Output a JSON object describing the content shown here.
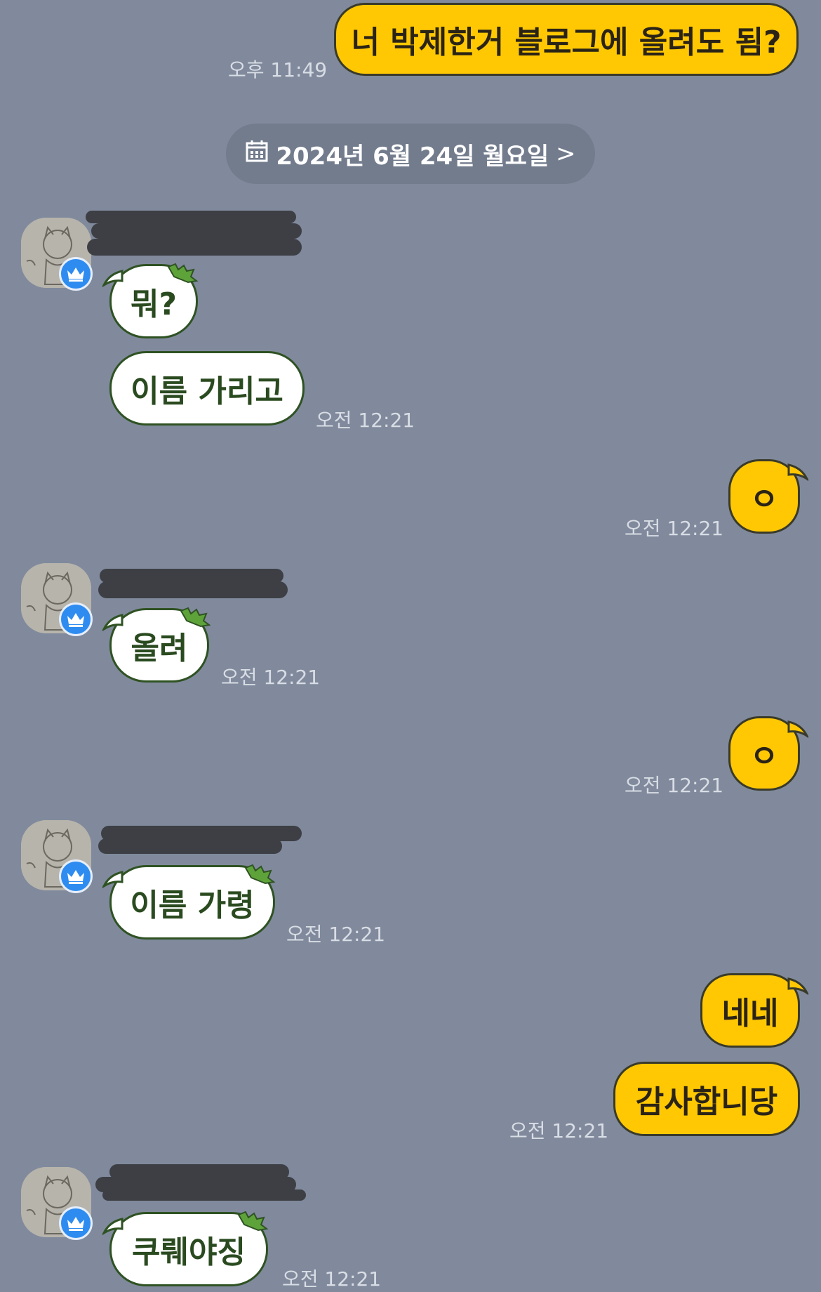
{
  "date_separator": {
    "label": "2024년 6월 24일 월요일",
    "chevron": ">"
  },
  "messages": {
    "m1": {
      "text": "너 박제한거 블로그에 올려도 됨?",
      "time": "오후 11:49"
    },
    "m2": {
      "text": "뭐?"
    },
    "m3": {
      "text": "이름 가리고",
      "time": "오전 12:21"
    },
    "m4": {
      "text": "ㅇ",
      "time": "오전 12:21"
    },
    "m5": {
      "text": "올려",
      "time": "오전 12:21"
    },
    "m6": {
      "text": "ㅇ",
      "time": "오전 12:21"
    },
    "m7": {
      "text": "이름 가령",
      "time": "오전 12:21"
    },
    "m8": {
      "text": "네네"
    },
    "m9": {
      "text": "감사합니당",
      "time": "오전 12:21"
    },
    "m10": {
      "text": "쿠뤠야징",
      "time": "오전 12:21"
    }
  },
  "icons": {
    "calendar": "calendar-icon",
    "crown": "crown-icon",
    "leaf": "leaf-decoration-icon"
  },
  "colors": {
    "background": "#808a9c",
    "my_bubble": "#ffc803",
    "other_bubble": "#ffffff",
    "other_text": "#2a4a1f",
    "badge": "#2e8cf0"
  }
}
